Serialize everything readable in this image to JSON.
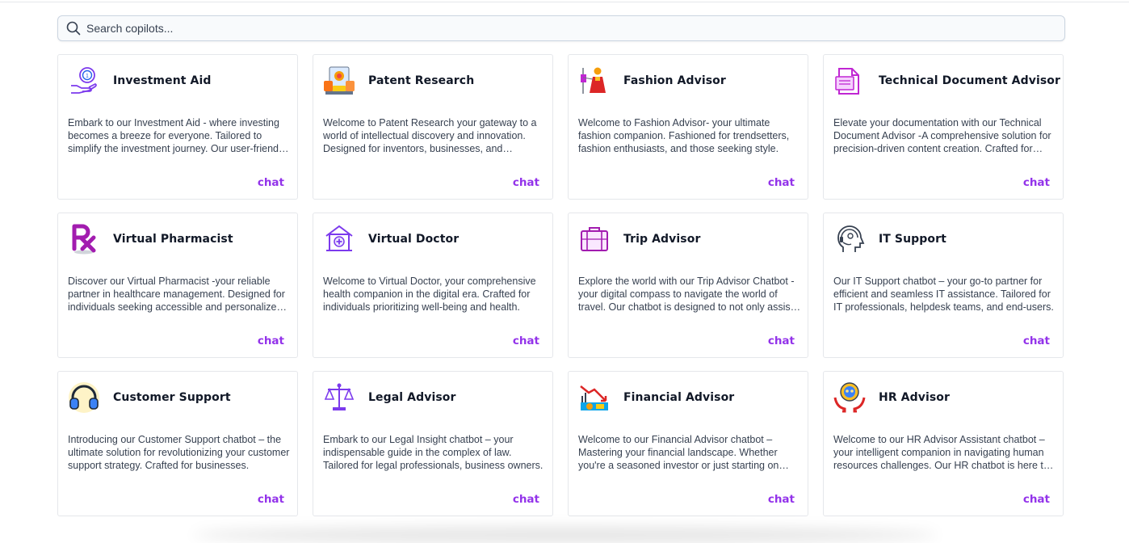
{
  "search": {
    "placeholder": "Search copilots..."
  },
  "cards": [
    {
      "title": "Investment Aid",
      "icon": "investment-icon",
      "chat": "chat",
      "description": "Embark to our Investment Aid - where investing becomes a breeze for everyone. Tailored to simplify the investment journey. Our user-friendly platform is designed for all."
    },
    {
      "title": "Patent Research",
      "icon": "patent-icon",
      "chat": "chat",
      "description": "Welcome to Patent Research your gateway to a world of intellectual discovery and innovation. Designed for inventors, businesses, and researchers."
    },
    {
      "title": "Fashion Advisor",
      "icon": "fashion-icon",
      "chat": "chat",
      "description": "Welcome to Fashion Advisor- your ultimate fashion companion. Fashioned for trendsetters, fashion enthusiasts, and those seeking style."
    },
    {
      "title": "Technical Document Advisor",
      "icon": "document-icon",
      "chat": "chat",
      "description": "Elevate your documentation with our Technical Document Advisor -A comprehensive solution for precision-driven content creation. Crafted for teams."
    },
    {
      "title": "Virtual Pharmacist",
      "icon": "rx-icon",
      "chat": "chat",
      "description": "Discover our Virtual Pharmacist -your reliable partner in healthcare management. Designed for individuals seeking accessible and personalized care."
    },
    {
      "title": "Virtual Doctor",
      "icon": "clinic-icon",
      "chat": "chat",
      "description": "Welcome to Virtual Doctor, your comprehensive health companion in the digital era. Crafted for individuals prioritizing well-being and health."
    },
    {
      "title": "Trip Advisor",
      "icon": "suitcase-icon",
      "chat": "chat",
      "description": "Explore the world with our Trip Advisor Chatbot - your digital compass to navigate the world of travel. Our chatbot is designed to not only assist you."
    },
    {
      "title": "IT Support",
      "icon": "it-support-icon",
      "chat": "chat",
      "description": "Our IT Support chatbot – your go-to partner for efficient and seamless IT assistance. Tailored for IT professionals, helpdesk teams, and end-users."
    },
    {
      "title": "Customer Support",
      "icon": "headphones-icon",
      "chat": "chat",
      "description": "Introducing our Customer Support chatbot – the ultimate solution for revolutionizing your customer support strategy. Crafted for businesses."
    },
    {
      "title": "Legal Advisor",
      "icon": "scales-icon",
      "chat": "chat",
      "description": "Embark to our Legal Insight chatbot – your indispensable guide in the complex of law. Tailored for legal professionals, business owners."
    },
    {
      "title": "Financial Advisor",
      "icon": "finance-chart-icon",
      "chat": "chat",
      "description": "Welcome to our Financial Advisor chatbot – Mastering your financial landscape. Whether you're a seasoned investor or just starting on your journey."
    },
    {
      "title": "HR Advisor",
      "icon": "hr-icon",
      "chat": "chat",
      "description": "Welcome to our HR Advisor Assistant chatbot – your intelligent companion in navigating human resources challenges. Our HR chatbot is here to help."
    }
  ]
}
